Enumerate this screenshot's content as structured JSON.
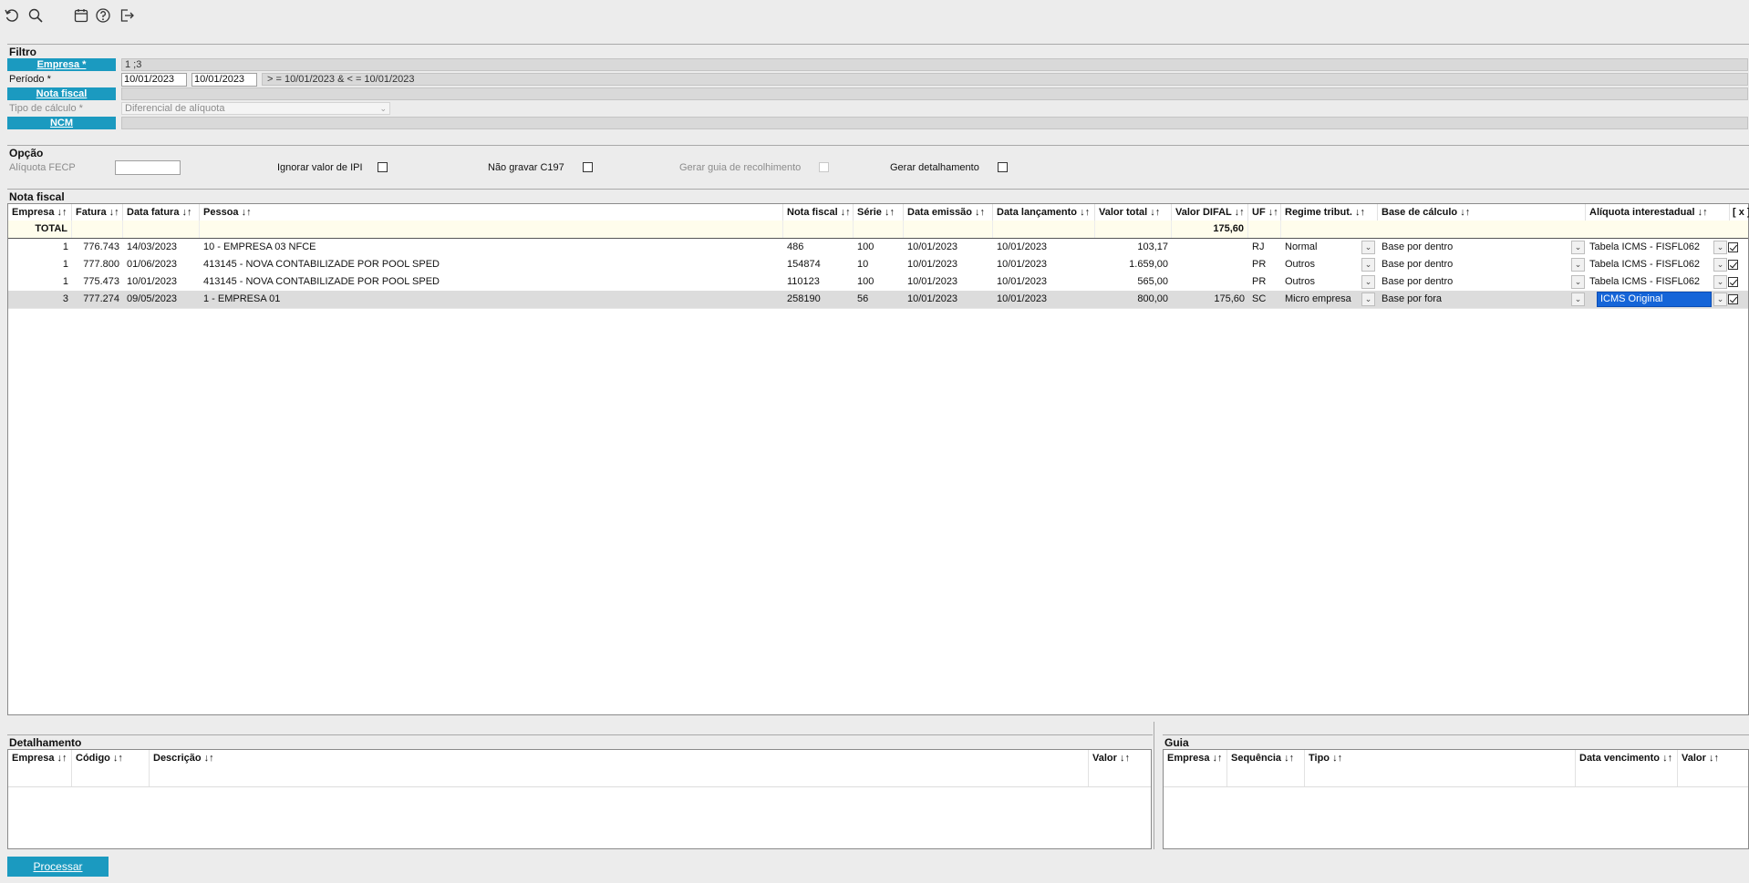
{
  "toolbar": {
    "icons": [
      "refresh-icon",
      "search-icon",
      "calendar-icon",
      "help-icon",
      "logout-icon"
    ]
  },
  "filtro": {
    "title": "Filtro",
    "empresa_label": "Empresa *",
    "empresa_value": "1 ;3",
    "periodo_label": "Período *",
    "periodo_from": "10/01/2023",
    "periodo_to": "10/01/2023",
    "periodo_expr": "> = 10/01/2023  &  < = 10/01/2023",
    "nota_label": "Nota fiscal",
    "nota_value": "",
    "tipo_label": "Tipo de cálculo *",
    "tipo_value": "Diferencial de alíquota",
    "ncm_label": "NCM",
    "ncm_value": ""
  },
  "opcao": {
    "title": "Opção",
    "aliquota_fecp_label": "Alíquota FECP",
    "aliquota_fecp_value": "",
    "ignorar_ipi_label": "Ignorar valor de IPI",
    "nao_gravar_label": "Não gravar C197",
    "gerar_guia_label": "Gerar guia de recolhimento",
    "gerar_detalhamento_label": "Gerar detalhamento"
  },
  "nota_fiscal": {
    "title": "Nota fiscal",
    "columns": [
      "Empresa ↓↑",
      "Fatura ↓↑",
      "Data fatura ↓↑",
      "Pessoa ↓↑",
      "Nota fiscal ↓↑",
      "Série ↓↑",
      "Data emissão ↓↑",
      "Data lançamento ↓↑",
      "Valor total ↓↑",
      "Valor DIFAL ↓↑",
      "UF ↓↑",
      "Regime tribut. ↓↑",
      "Base de cálculo ↓↑",
      "Alíquota interestadual ↓↑",
      "[ x ]"
    ],
    "total_label": "TOTAL",
    "total_difal": "175,60",
    "rows": [
      {
        "empresa": "1",
        "fatura": "776.743",
        "data_fatura": "14/03/2023",
        "pessoa": "10 - EMPRESA 03 NFCE",
        "nota": "486",
        "serie": "100",
        "emissao": "10/01/2023",
        "lancamento": "10/01/2023",
        "valor_total": "103,17",
        "valor_difal": "",
        "uf": "RJ",
        "regime": "Normal",
        "base": "Base por dentro",
        "aliquota": "Tabela ICMS - FISFL062",
        "checked": true,
        "selected": false
      },
      {
        "empresa": "1",
        "fatura": "777.800",
        "data_fatura": "01/06/2023",
        "pessoa": "413145 - NOVA CONTABILIZADE POR POOL SPED",
        "nota": "154874",
        "serie": "10",
        "emissao": "10/01/2023",
        "lancamento": "10/01/2023",
        "valor_total": "1.659,00",
        "valor_difal": "",
        "uf": "PR",
        "regime": "Outros",
        "base": "Base por dentro",
        "aliquota": "Tabela ICMS - FISFL062",
        "checked": true,
        "selected": false
      },
      {
        "empresa": "1",
        "fatura": "775.473",
        "data_fatura": "10/01/2023",
        "pessoa": "413145 - NOVA CONTABILIZADE POR POOL SPED",
        "nota": "110123",
        "serie": "100",
        "emissao": "10/01/2023",
        "lancamento": "10/01/2023",
        "valor_total": "565,00",
        "valor_difal": "",
        "uf": "PR",
        "regime": "Outros",
        "base": "Base por dentro",
        "aliquota": "Tabela ICMS - FISFL062",
        "checked": true,
        "selected": false
      },
      {
        "empresa": "3",
        "fatura": "777.274",
        "data_fatura": "09/05/2023",
        "pessoa": "1 - EMPRESA 01",
        "nota": "258190",
        "serie": "56",
        "emissao": "10/01/2023",
        "lancamento": "10/01/2023",
        "valor_total": "800,00",
        "valor_difal": "175,60",
        "uf": "SC",
        "regime": "Micro empresa",
        "base": "Base por fora",
        "aliquota": "ICMS Original",
        "checked": true,
        "selected": true
      }
    ]
  },
  "detalhamento": {
    "title": "Detalhamento",
    "columns": [
      "Empresa ↓↑",
      "Código ↓↑",
      "Descrição ↓↑",
      "Valor ↓↑"
    ]
  },
  "guia": {
    "title": "Guia",
    "columns": [
      "Empresa ↓↑",
      "Sequência ↓↑",
      "Tipo ↓↑",
      "Data vencimento ↓↑",
      "Valor ↓↑"
    ]
  },
  "actions": {
    "processar": "Processar"
  }
}
